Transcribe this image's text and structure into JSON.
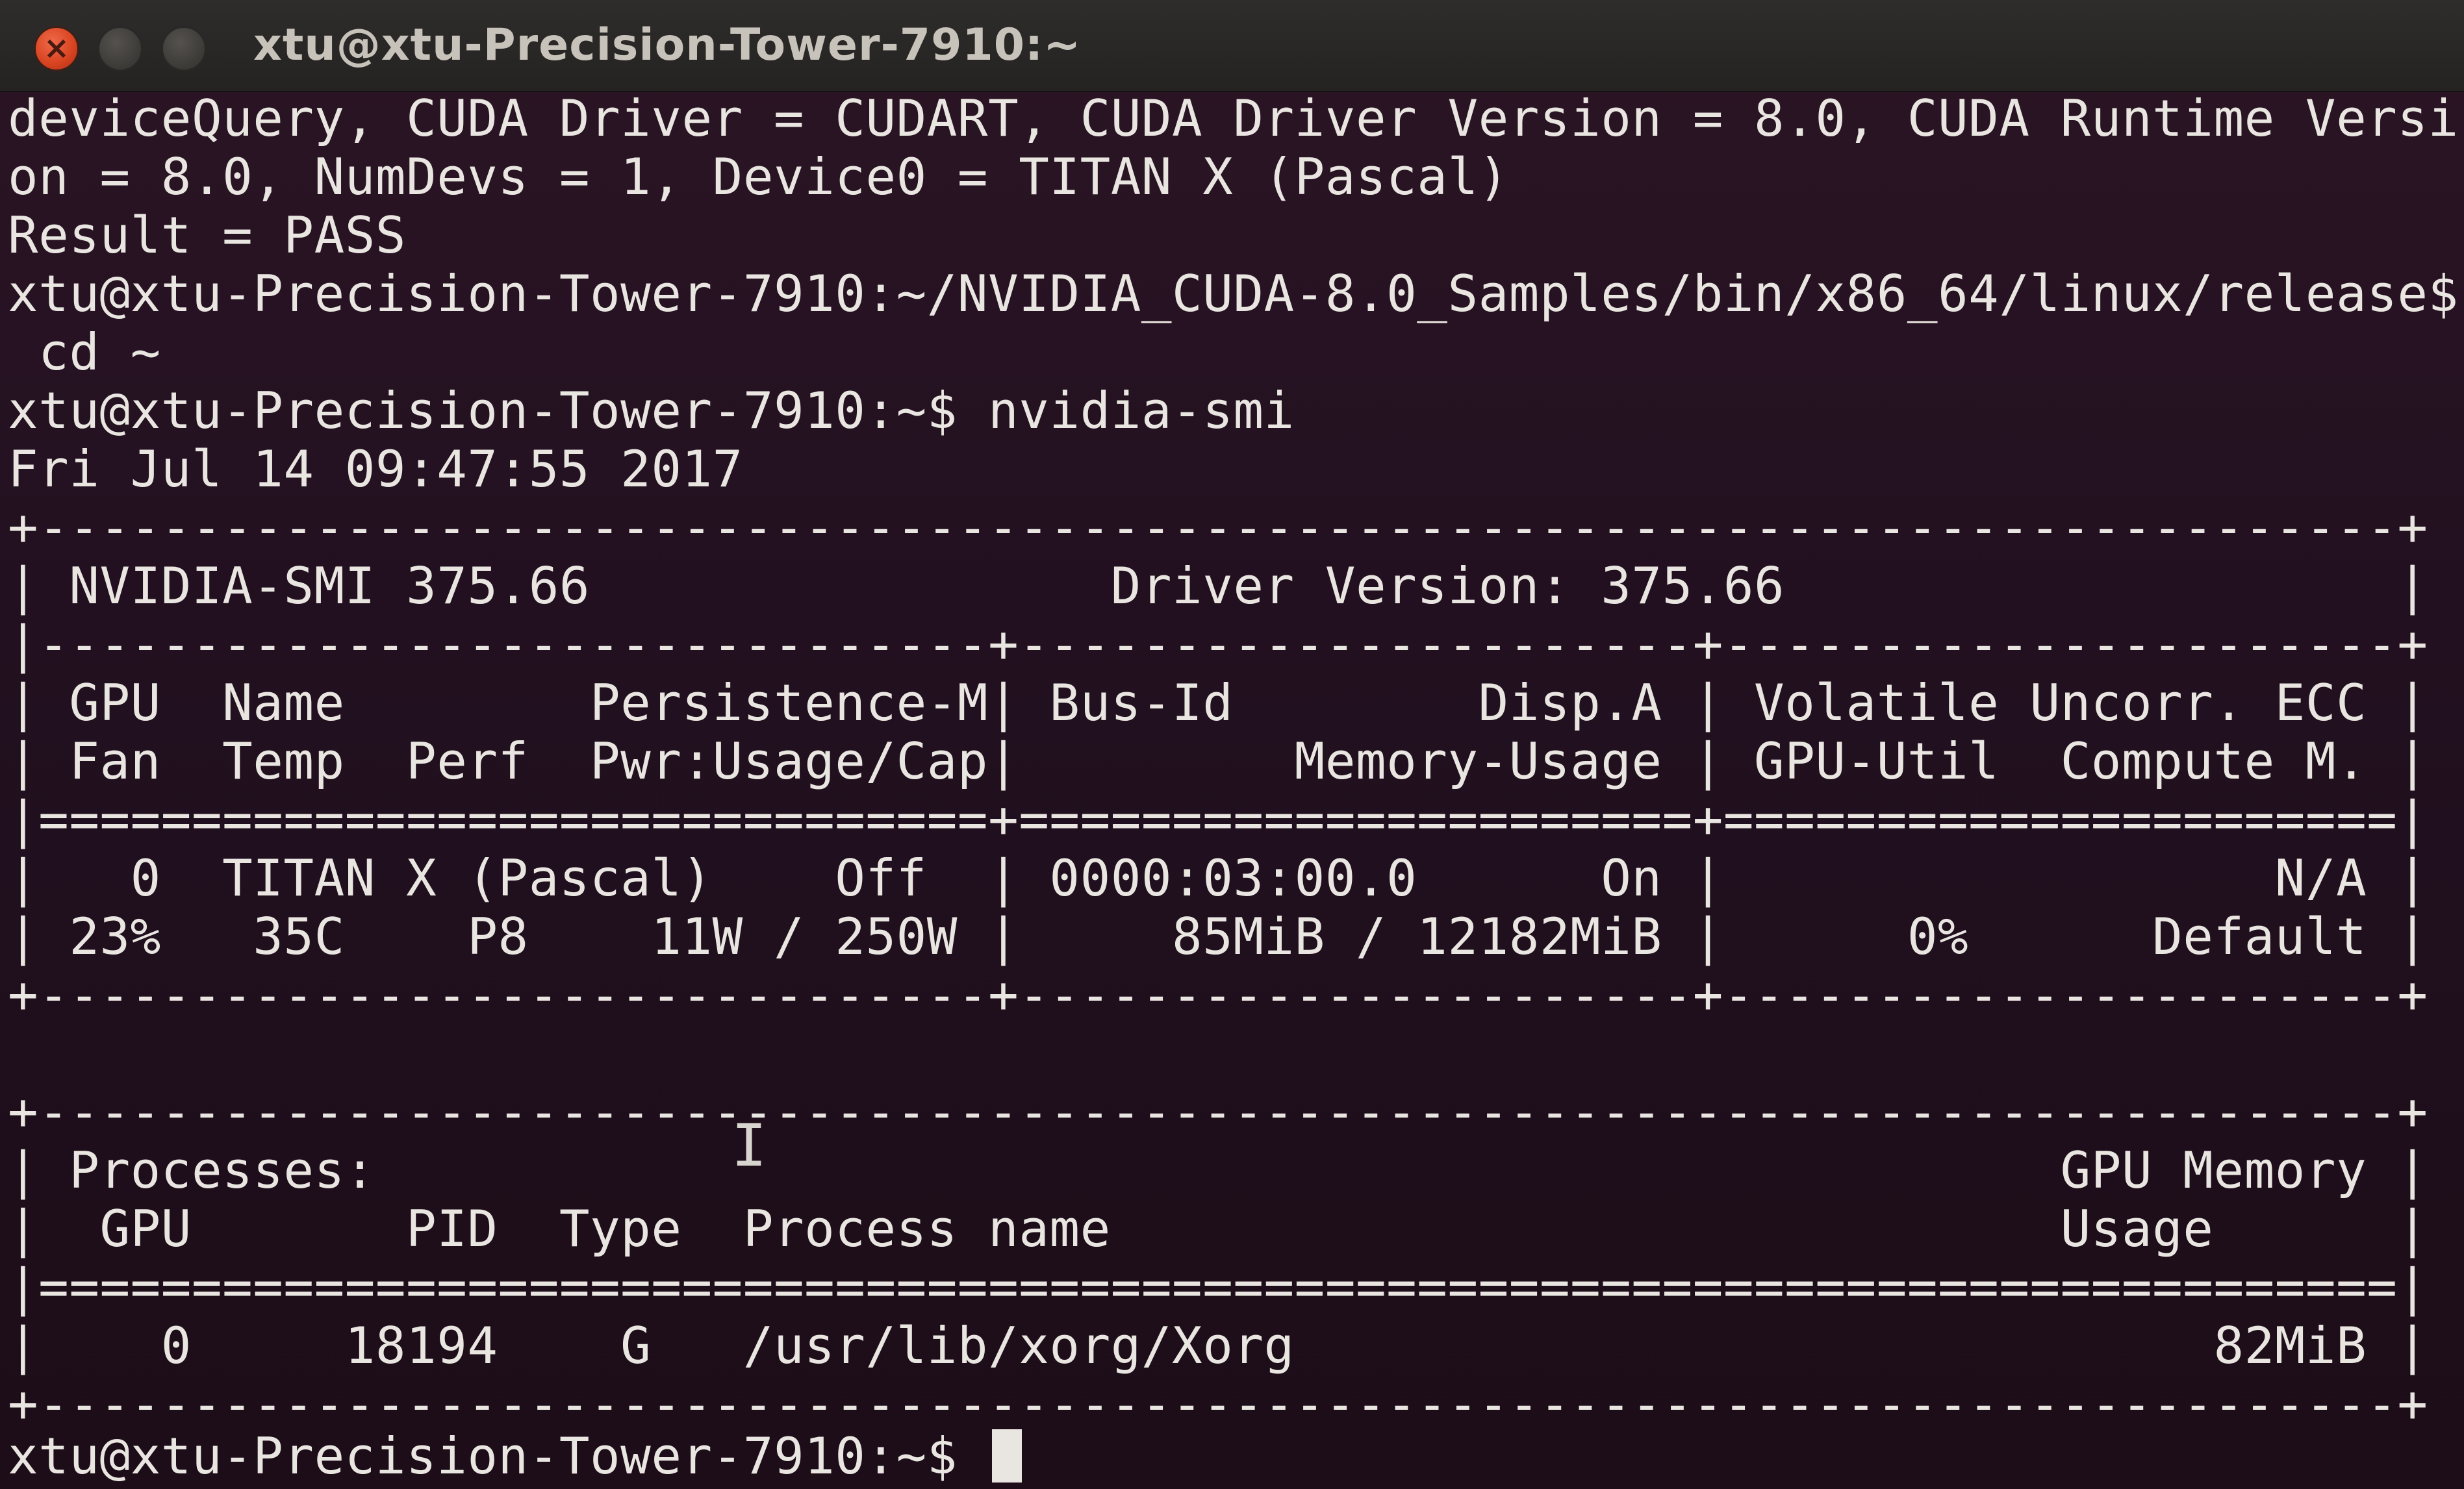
{
  "window": {
    "title": "xtu@xtu-Precision-Tower-7910:~",
    "buttons": {
      "close": "close-icon",
      "minimize": "minimize-icon",
      "maximize": "maximize-icon"
    },
    "colors": {
      "terminal_bg": "#2b1524",
      "text": "#e9e5e0",
      "close_button": "#d7421f"
    }
  },
  "terminal": {
    "lines": [
      "deviceQuery, CUDA Driver = CUDART, CUDA Driver Version = 8.0, CUDA Runtime Versi",
      "on = 8.0, NumDevs = 1, Device0 = TITAN X (Pascal)",
      "Result = PASS",
      "xtu@xtu-Precision-Tower-7910:~/NVIDIA_CUDA-8.0_Samples/bin/x86_64/linux/release$",
      " cd ~",
      "xtu@xtu-Precision-Tower-7910:~$ nvidia-smi",
      "Fri Jul 14 09:47:55 2017",
      "+-----------------------------------------------------------------------------+",
      "| NVIDIA-SMI 375.66                 Driver Version: 375.66                    |",
      "|-------------------------------+----------------------+----------------------+",
      "| GPU  Name        Persistence-M| Bus-Id        Disp.A | Volatile Uncorr. ECC |",
      "| Fan  Temp  Perf  Pwr:Usage/Cap|         Memory-Usage | GPU-Util  Compute M. |",
      "|===============================+======================+======================|",
      "|   0  TITAN X (Pascal)    Off  | 0000:03:00.0      On |                  N/A |",
      "| 23%   35C    P8    11W / 250W |     85MiB / 12182MiB |      0%      Default |",
      "+-------------------------------+----------------------+----------------------+",
      "",
      "+-----------------------------------------------------------------------------+",
      "| Processes:                                                       GPU Memory |",
      "|  GPU       PID  Type  Process name                               Usage      |",
      "|=============================================================================|",
      "|    0     18194    G   /usr/lib/xorg/Xorg                              82MiB |",
      "+-----------------------------------------------------------------------------+"
    ],
    "prompt": "xtu@xtu-Precision-Tower-7910:~$ "
  }
}
